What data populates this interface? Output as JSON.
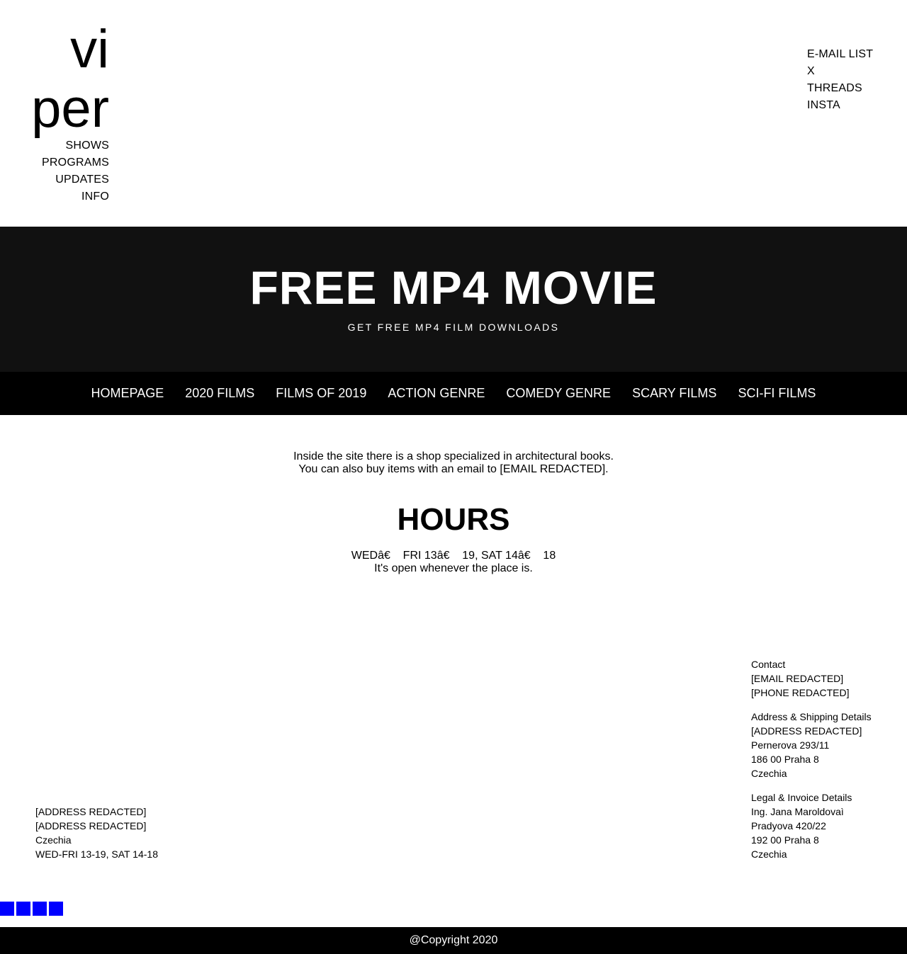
{
  "logo": {
    "line1": "vi",
    "line2": "per"
  },
  "left_nav": [
    "SHOWS",
    "PROGRAMS",
    "UPDATES",
    "INFO"
  ],
  "right_nav": [
    "E-MAIL LIST",
    "X",
    "THREADS",
    "INSTA"
  ],
  "hero": {
    "title": "FREE MP4 MOVIE",
    "subtitle": "GET FREE MP4 FILM DOWNLOADS"
  },
  "menu": [
    "HOMEPAGE",
    "2020 FILMS",
    "FILMS OF 2019",
    "ACTION GENRE",
    "COMEDY GENRE",
    "SCARY FILMS",
    "SCI-FI FILMS"
  ],
  "intro": {
    "line1": "Inside the site there is a shop specialized in architectural books.",
    "line2": "You can also buy items with an email to [EMAIL REDACTED]."
  },
  "hours": {
    "title": "HOURS",
    "line1": "WEDâ€    FRI 13â€    19, SAT 14â€    18",
    "line2": "It's open whenever the place is."
  },
  "footer_left": [
    "[ADDRESS REDACTED]",
    "[ADDRESS REDACTED]",
    "Czechia",
    "WED-FRI 13-19, SAT 14-18"
  ],
  "footer_right": {
    "contact": [
      "Contact",
      "[EMAIL REDACTED]",
      "[PHONE REDACTED]"
    ],
    "address": [
      "Address & Shipping Details",
      "[ADDRESS REDACTED]",
      "Pernerova 293/11",
      "186 00 Praha 8",
      "Czechia"
    ],
    "legal": [
      "Legal & Invoice Details",
      "Ing. Jana Maroldovaì",
      "Pradyova 420/22",
      "192 00 Praha 8",
      "Czechia"
    ]
  },
  "colors": {
    "square_accent": "#0000ff",
    "hero_bg": "#111111",
    "menu_bg": "#000000"
  },
  "copyright": "@Copyright 2020"
}
